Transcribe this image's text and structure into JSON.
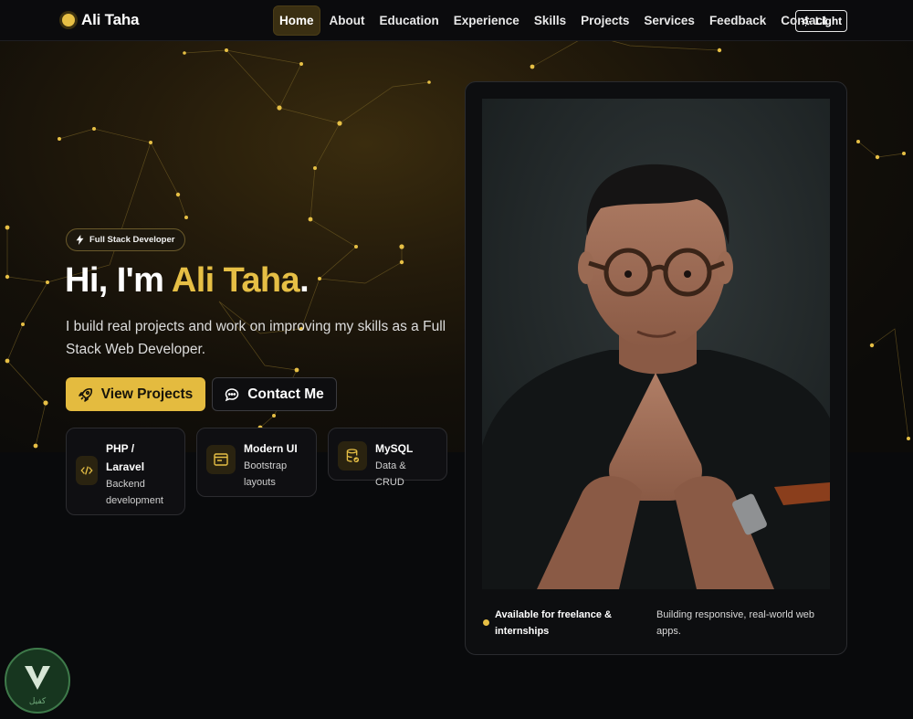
{
  "brand": {
    "name": "Ali Taha"
  },
  "nav": {
    "links": [
      "Home",
      "About",
      "Education",
      "Experience",
      "Skills",
      "Projects",
      "Services",
      "Feedback",
      "Contact"
    ],
    "active": "Home",
    "theme_toggle": "Light"
  },
  "hero": {
    "badge": "Full Stack Developer",
    "greeting": "Hi, I'm",
    "name": "Ali Taha",
    "period": ".",
    "subtitle": "I build real projects and work on improving my skills as a Full Stack Web Developer.",
    "primary_button": "View Projects",
    "secondary_button": "Contact Me"
  },
  "features": [
    {
      "title": "PHP / Laravel",
      "description": "Backend development",
      "icon": "code-icon"
    },
    {
      "title": "Modern UI",
      "description": "Bootstrap layouts",
      "icon": "browser-window-icon"
    },
    {
      "title": "MySQL",
      "description": "Data & CRUD",
      "icon": "database-icon"
    }
  ],
  "profile_card": {
    "availability": "Available for freelance & internships",
    "tagline": "Building responsive, real-world web apps."
  },
  "watermark": {
    "text": "كفيل"
  },
  "colors": {
    "accent": "#e6bf45",
    "background": "#08090b",
    "card": "#0f0f12"
  }
}
